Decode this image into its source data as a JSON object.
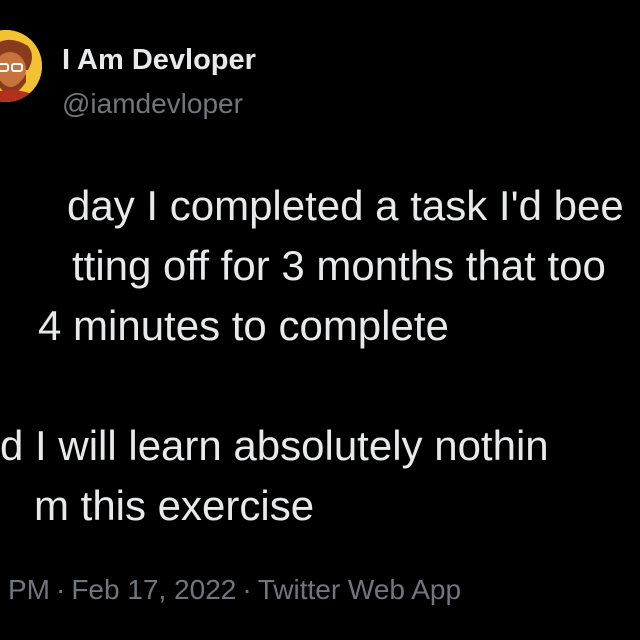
{
  "author": {
    "display_name": "I Am Devloper",
    "handle": "@iamdevloper",
    "avatar_icon": "developer-avatar-icon",
    "avatar_bg": "#f2c232"
  },
  "tweet": {
    "lines": [
      "day I completed a task I'd bee",
      "tting off for 3 months that too",
      "4 minutes to complete",
      "d I will learn absolutely nothin",
      "m this exercise"
    ]
  },
  "meta": {
    "time": "PM",
    "date": "Feb 17, 2022",
    "source": "Twitter Web App",
    "separator": "·"
  },
  "colors": {
    "background": "#000000",
    "primary_text": "#e7e9ea",
    "secondary_text": "#71767b"
  }
}
